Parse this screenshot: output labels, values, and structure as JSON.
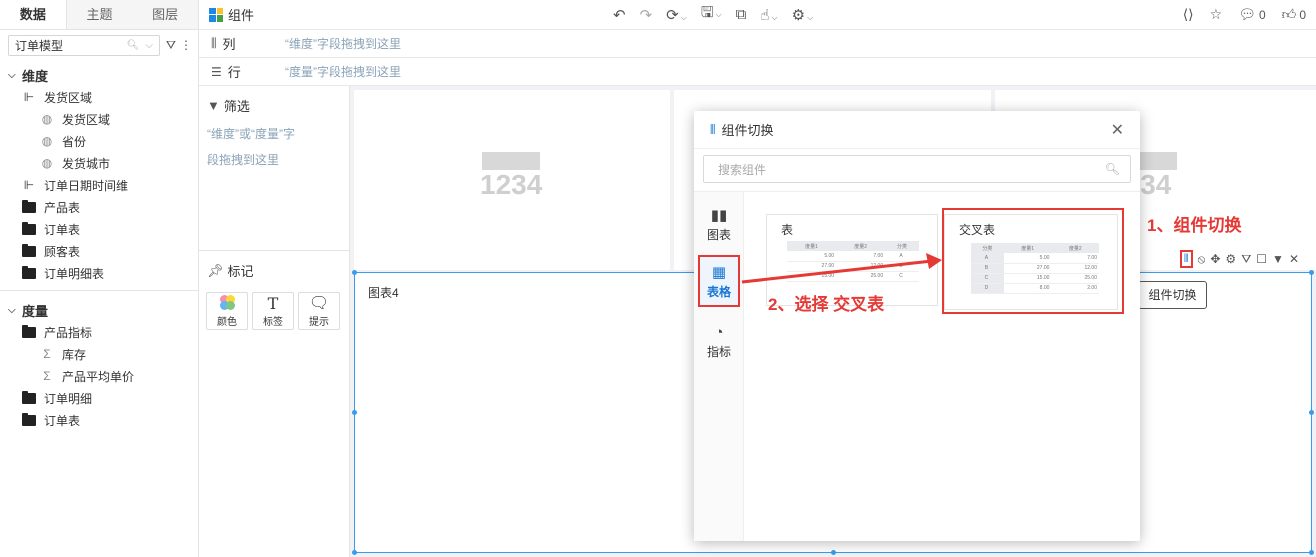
{
  "left_panel": {
    "tabs": [
      "数据",
      "主题",
      "图层"
    ],
    "model": "订单模型",
    "dimensions_title": "维度",
    "dimensions": [
      {
        "label": "发货区域",
        "level": 1,
        "icon": "hierarchy-icon"
      },
      {
        "label": "发货区域",
        "level": 2,
        "icon": "globe-icon"
      },
      {
        "label": "省份",
        "level": 2,
        "icon": "globe-icon"
      },
      {
        "label": "发货城市",
        "level": 2,
        "icon": "globe-icon"
      },
      {
        "label": "订单日期时间维",
        "level": 1,
        "icon": "hierarchy-icon"
      },
      {
        "label": "产品表",
        "level": 1,
        "icon": "folder-icon"
      },
      {
        "label": "订单表",
        "level": 1,
        "icon": "folder-icon"
      },
      {
        "label": "顾客表",
        "level": 1,
        "icon": "folder-icon"
      },
      {
        "label": "订单明细表",
        "level": 1,
        "icon": "folder-icon"
      }
    ],
    "measures_title": "度量",
    "measures": [
      {
        "label": "产品指标",
        "level": 1,
        "icon": "folder-icon"
      },
      {
        "label": "库存",
        "level": 2,
        "icon": "sigma-icon"
      },
      {
        "label": "产品平均单价",
        "level": 2,
        "icon": "sigma-icon"
      },
      {
        "label": "订单明细",
        "level": 1,
        "icon": "folder-icon"
      },
      {
        "label": "订单表",
        "level": 1,
        "icon": "folder-icon"
      }
    ]
  },
  "topbar": {
    "title": "组件",
    "like_count": "0",
    "comment_count": "0"
  },
  "shelves": {
    "column_label": "列",
    "column_hint": "“维度”字段拖拽到这里",
    "row_label": "行",
    "row_hint": "“度量”字段拖拽到这里"
  },
  "filter": {
    "title": "筛选",
    "hint_line1": "“维度”或“度量”字",
    "hint_line2": "段拖拽到这里"
  },
  "marks": {
    "title": "标记",
    "buttons": [
      "颜色",
      "标签",
      "提示"
    ]
  },
  "canvas": {
    "placeholder_number": "1234",
    "placeholder_number_partial": "234",
    "chart_title": "图表4",
    "tooltip": "组件切换"
  },
  "modal": {
    "title": "组件切换",
    "search_placeholder": "搜索组件",
    "categories": [
      "图表",
      "表格",
      "指标"
    ],
    "items": [
      {
        "title": "表",
        "headers": [
          "度量1",
          "度量2",
          "分类"
        ],
        "rows": [
          [
            "5.00",
            "7.00",
            "A"
          ],
          [
            "27.00",
            "12.00",
            "B"
          ],
          [
            "15.00",
            "25.00",
            "C"
          ]
        ]
      },
      {
        "title": "交叉表",
        "headers": [
          "分类",
          "度量1",
          "度量2"
        ],
        "rows": [
          [
            "A",
            "5.00",
            "7.00"
          ],
          [
            "B",
            "27.00",
            "12.00"
          ],
          [
            "C",
            "15.00",
            "25.00"
          ],
          [
            "D",
            "8.00",
            "2.00"
          ]
        ]
      }
    ]
  },
  "annotations": {
    "step1": "1、组件切换",
    "step2": "2、选择 交叉表"
  },
  "colors": {
    "accent": "#1976d2",
    "annotation_red": "#e53935",
    "selection_blue": "#3a9bea"
  }
}
